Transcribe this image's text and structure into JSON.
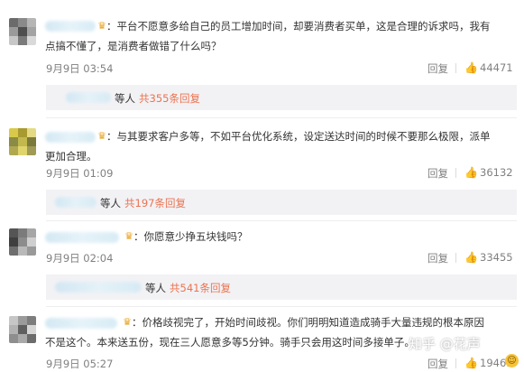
{
  "comments": [
    {
      "lines": [
        "：平台不愿意多给自己的员工增加时间，却要消费者买单，这是合理的诉求吗，我有",
        "点搞不懂了，是消费者做错了什么吗？"
      ],
      "time": "9月9日 03:54",
      "reply": "回复",
      "likes": "44471",
      "thread": {
        "who": "等人",
        "more": "共355条回复"
      }
    },
    {
      "lines": [
        "：与其要求客户多等，不如平台优化系统，设定送达时间的时候不要那么极限，派单",
        "更加合理。"
      ],
      "time": "9月9日 01:09",
      "reply": "回复",
      "likes": "36132",
      "thread": {
        "who": "等人",
        "more": "共197条回复"
      }
    },
    {
      "lines": [
        "：你愿意少挣五块钱吗？"
      ],
      "time": "9月9日 02:04",
      "reply": "回复",
      "likes": "33455",
      "thread": {
        "who": "等人",
        "more": "共541条回复"
      }
    },
    {
      "lines": [
        "：价格歧视完了，开始时间歧视。你们明明知道造成骑手大量违规的根本原因",
        "不是这个。本来送五份，现在三人愿意多等5分钟。骑手只会用这时间多接单子。"
      ],
      "time": "9月9日 05:27",
      "reply": "回复",
      "likes": "19461"
    }
  ],
  "watermark": "知乎 @花声",
  "colors": {
    "accent": "#eb7350",
    "meta": "#808080",
    "thread_bg": "#f2f2f5"
  },
  "icons": {
    "like": "thumb-up-icon",
    "vip": "vip-badge-icon",
    "emoji": "smile-emoji-icon"
  }
}
